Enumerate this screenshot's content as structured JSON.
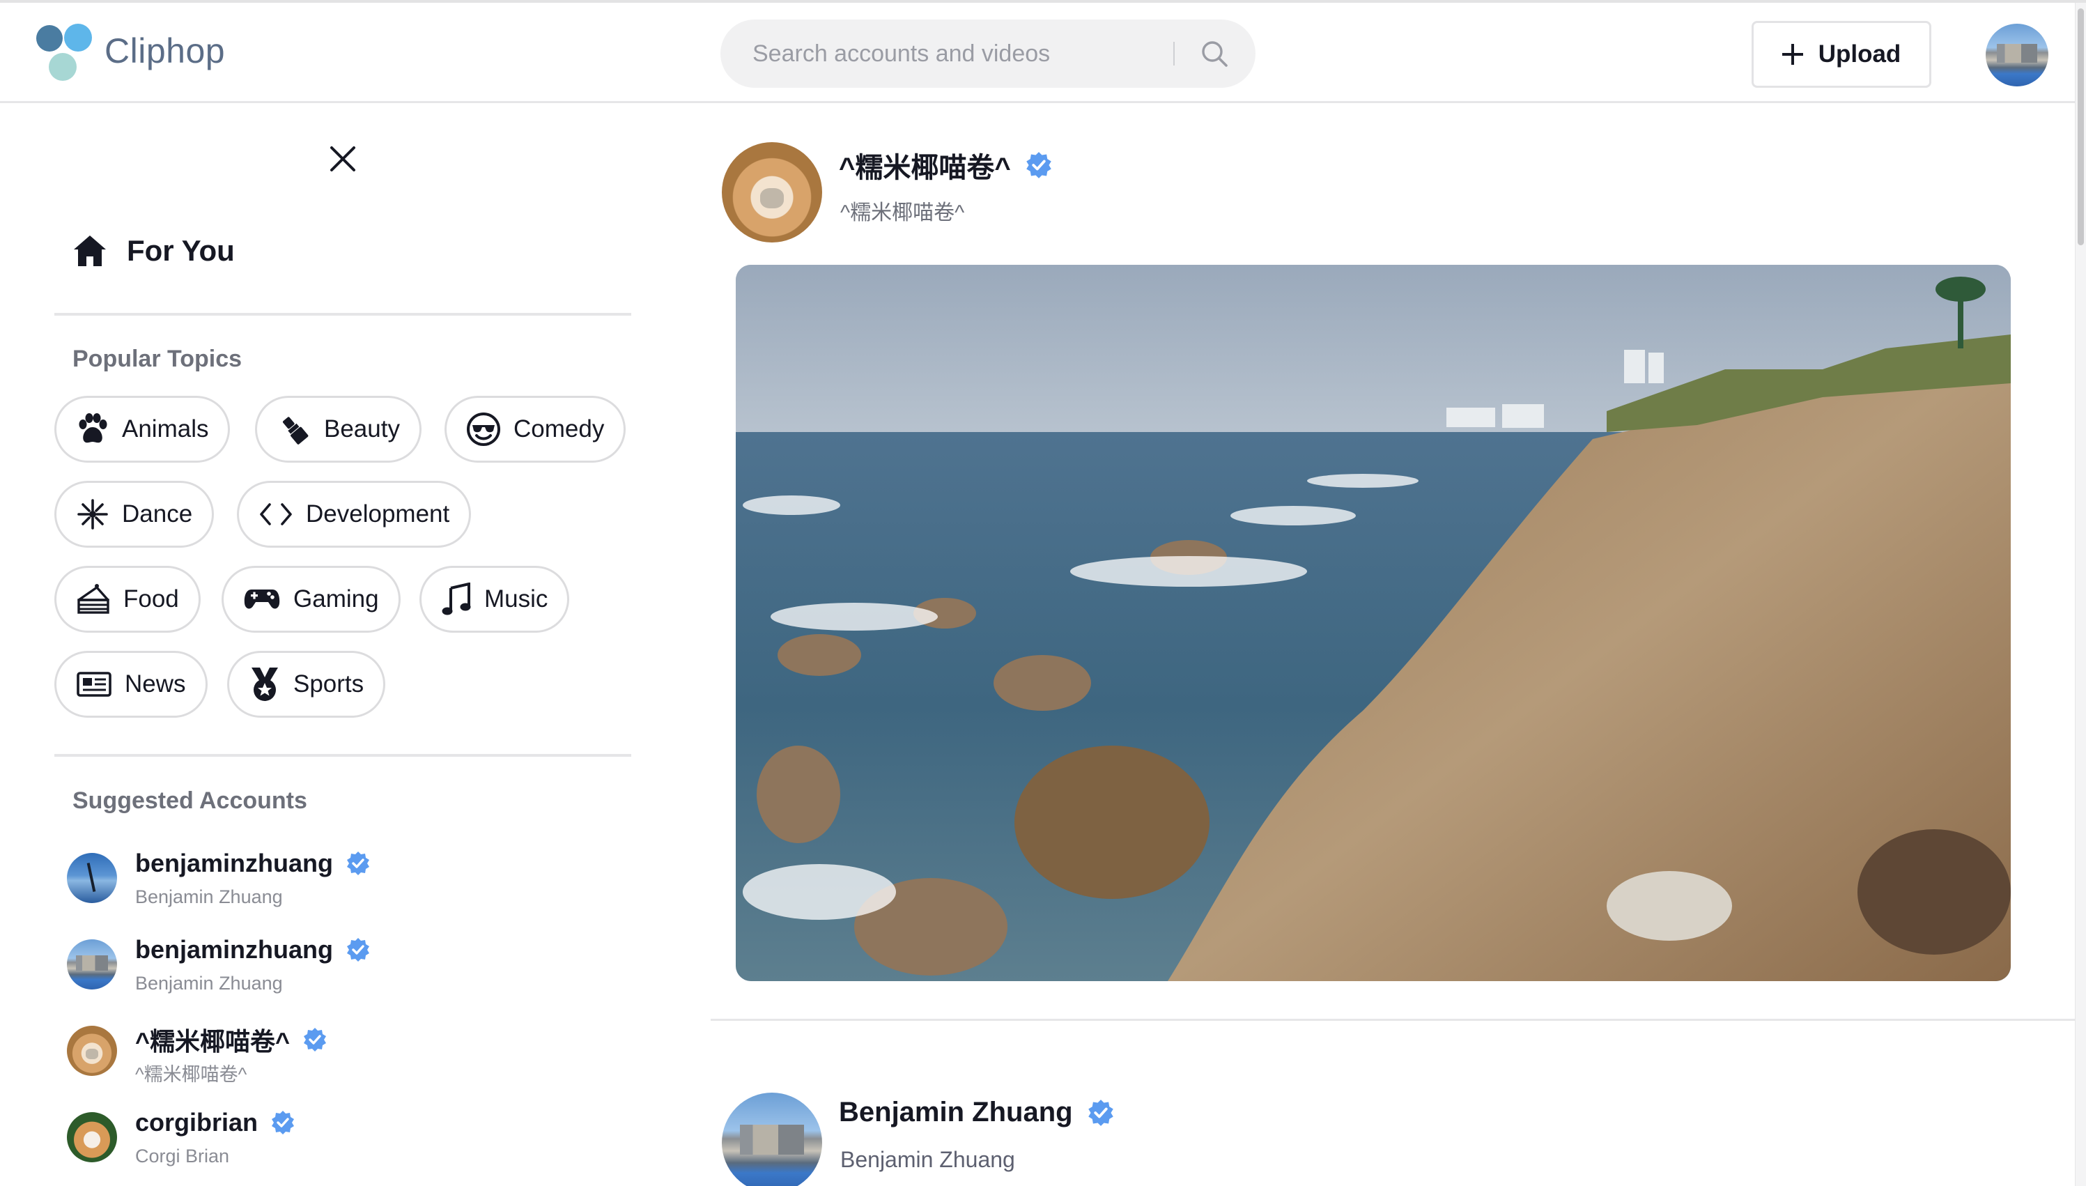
{
  "app": {
    "brand": "Cliphop"
  },
  "header": {
    "search_placeholder": "Search accounts and videos",
    "upload_label": "Upload"
  },
  "sidebar": {
    "for_you_label": "For You",
    "popular_topics_title": "Popular Topics",
    "topics": [
      {
        "label": "Animals",
        "icon": "paw-icon"
      },
      {
        "label": "Beauty",
        "icon": "lipstick-icon"
      },
      {
        "label": "Comedy",
        "icon": "sunglasses-face-icon"
      },
      {
        "label": "Dance",
        "icon": "dance-burst-icon"
      },
      {
        "label": "Development",
        "icon": "code-icon"
      },
      {
        "label": "Food",
        "icon": "cake-icon"
      },
      {
        "label": "Gaming",
        "icon": "gamepad-icon"
      },
      {
        "label": "Music",
        "icon": "music-note-icon"
      },
      {
        "label": "News",
        "icon": "newspaper-icon"
      },
      {
        "label": "Sports",
        "icon": "medal-icon"
      }
    ],
    "suggested_title": "Suggested Accounts",
    "accounts": [
      {
        "handle": "benjaminzhuang",
        "name": "Benjamin Zhuang",
        "verified": true
      },
      {
        "handle": "benjaminzhuang",
        "name": "Benjamin Zhuang",
        "verified": true
      },
      {
        "handle": "^糯米椰喵卷^",
        "name": "^糯米椰喵卷^",
        "verified": true
      },
      {
        "handle": "corgibrian",
        "name": "Corgi Brian",
        "verified": true
      }
    ]
  },
  "feed": {
    "posts": [
      {
        "handle": "^糯米椰喵卷^",
        "name": "^糯米椰喵卷^",
        "verified": true
      },
      {
        "handle": "Benjamin Zhuang",
        "name": "Benjamin Zhuang",
        "verified": true
      }
    ]
  },
  "colors": {
    "brand_text": "#5b6d87",
    "verified_blue": "#5b9bf0",
    "pill_border": "#dcdcde",
    "divider": "#e5e5e7"
  }
}
